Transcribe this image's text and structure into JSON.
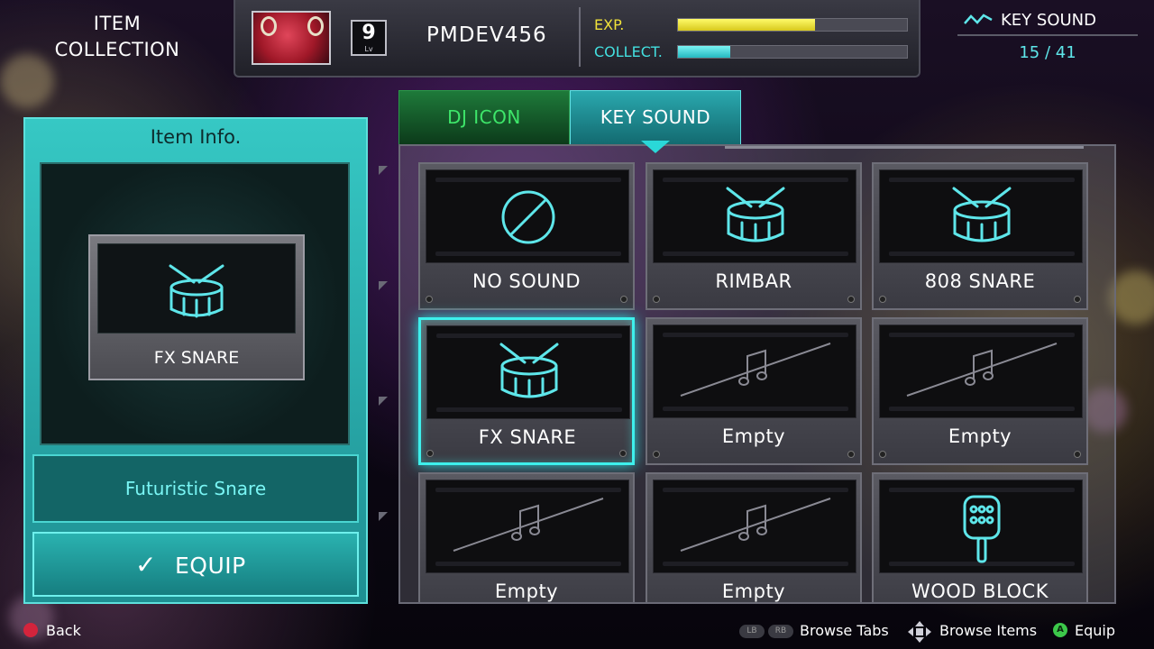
{
  "screen": {
    "title": "ITEM\nCOLLECTION"
  },
  "profile": {
    "username": "PMDEV456",
    "level": "9",
    "level_tag": "Lv",
    "exp_label": "EXP.",
    "collect_label": "COLLECT.",
    "exp_progress": 0.6,
    "collect_progress": 0.23
  },
  "counter": {
    "title": "KEY SOUND",
    "value": "15 / 41",
    "icon": "waveform-icon"
  },
  "info": {
    "title": "Item Info.",
    "preview_name": "FX SNARE",
    "preview_icon": "drum-icon",
    "description": "Futuristic Snare",
    "equip_label": "EQUIP",
    "equip_icon": "checkmark-icon"
  },
  "tabs": [
    {
      "label": "DJ ICON",
      "active": false
    },
    {
      "label": "KEY SOUND",
      "active": true
    }
  ],
  "items": [
    {
      "label": "NO SOUND",
      "icon": "no-sound-icon",
      "selected": false
    },
    {
      "label": "RIMBAR",
      "icon": "drum-icon",
      "selected": false
    },
    {
      "label": "808 SNARE",
      "icon": "drum-icon",
      "selected": false
    },
    {
      "label": "FX SNARE",
      "icon": "drum-icon",
      "selected": true
    },
    {
      "label": "Empty",
      "icon": "music-note-icon",
      "selected": false
    },
    {
      "label": "Empty",
      "icon": "music-note-icon",
      "selected": false
    },
    {
      "label": "Empty",
      "icon": "music-note-icon",
      "selected": false
    },
    {
      "label": "Empty",
      "icon": "music-note-icon",
      "selected": false
    },
    {
      "label": "WOOD BLOCK",
      "icon": "wood-block-icon",
      "selected": false
    }
  ],
  "hints": {
    "back": "Back",
    "lb": "LB",
    "rb": "RB",
    "browse_tabs": "Browse Tabs",
    "browse_items": "Browse Items",
    "a_button": "A",
    "equip": "Equip"
  },
  "colors": {
    "accent": "#3ef0ec",
    "exp": "#f0e23a",
    "collect": "#43e0e0",
    "dj_tab": "#3ee66a"
  }
}
